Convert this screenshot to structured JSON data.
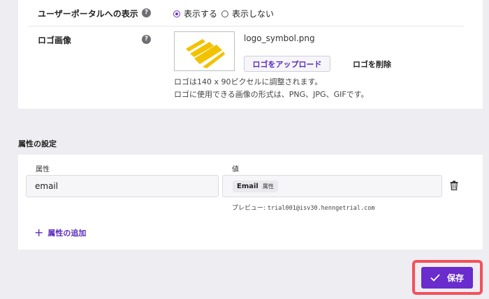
{
  "portal_display": {
    "label": "ユーザーポータルへの表示",
    "help": "?",
    "options": [
      {
        "label": "表示する",
        "selected": true
      },
      {
        "label": "表示しない",
        "selected": false
      }
    ]
  },
  "logo": {
    "label": "ロゴ画像",
    "help": "?",
    "filename": "logo_symbol.png",
    "upload_label": "ロゴをアップロード",
    "delete_label": "ロゴを削除",
    "note_size": "ロゴは140 x 90ピクセルに調整されます。",
    "note_format": "ロゴに使用できる画像の形式は、PNG、JPG、GIFです。",
    "logo_color": "#f2c200"
  },
  "attributes": {
    "title": "属性の設定",
    "col_attribute": "属性",
    "col_value": "値",
    "rows": [
      {
        "attribute": "email",
        "value_chip": "Email",
        "value_chip_type": "属性"
      }
    ],
    "preview_label": "プレビュー:",
    "preview_value": "trial001@isv30.henngetrial.com",
    "add_label": "属性の追加",
    "add_icon": "+"
  },
  "save": {
    "label": "保存",
    "accent": "#6a2ccc",
    "highlight": "#f4505a"
  }
}
